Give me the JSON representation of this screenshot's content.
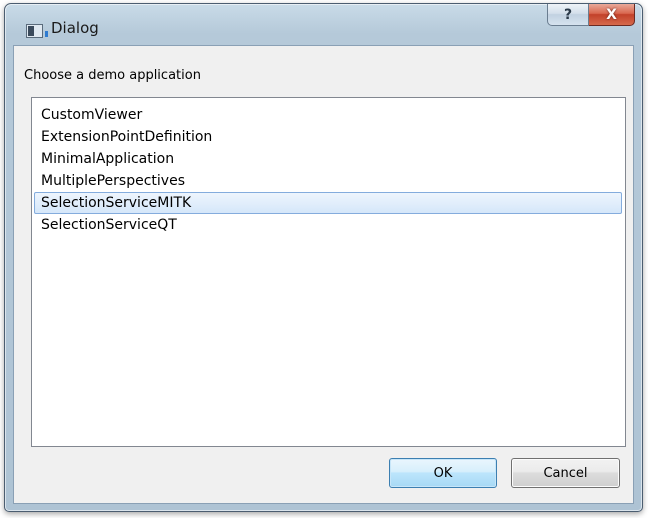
{
  "window": {
    "title": "Dialog",
    "help_symbol": "?",
    "close_symbol": "X"
  },
  "prompt": "Choose a demo application",
  "list": {
    "items": [
      "CustomViewer",
      "ExtensionPointDefinition",
      "MinimalApplication",
      "MultiplePerspectives",
      "SelectionServiceMITK",
      "SelectionServiceQT"
    ],
    "selected_item": "SelectionServiceMITK"
  },
  "buttons": {
    "ok_label": "OK",
    "cancel_label": "Cancel"
  },
  "colors": {
    "selection_fill": "#d5e7fa",
    "selection_border": "#84acdd",
    "default_button_border": "#3c7fb1",
    "close_button": "#c2412a"
  }
}
